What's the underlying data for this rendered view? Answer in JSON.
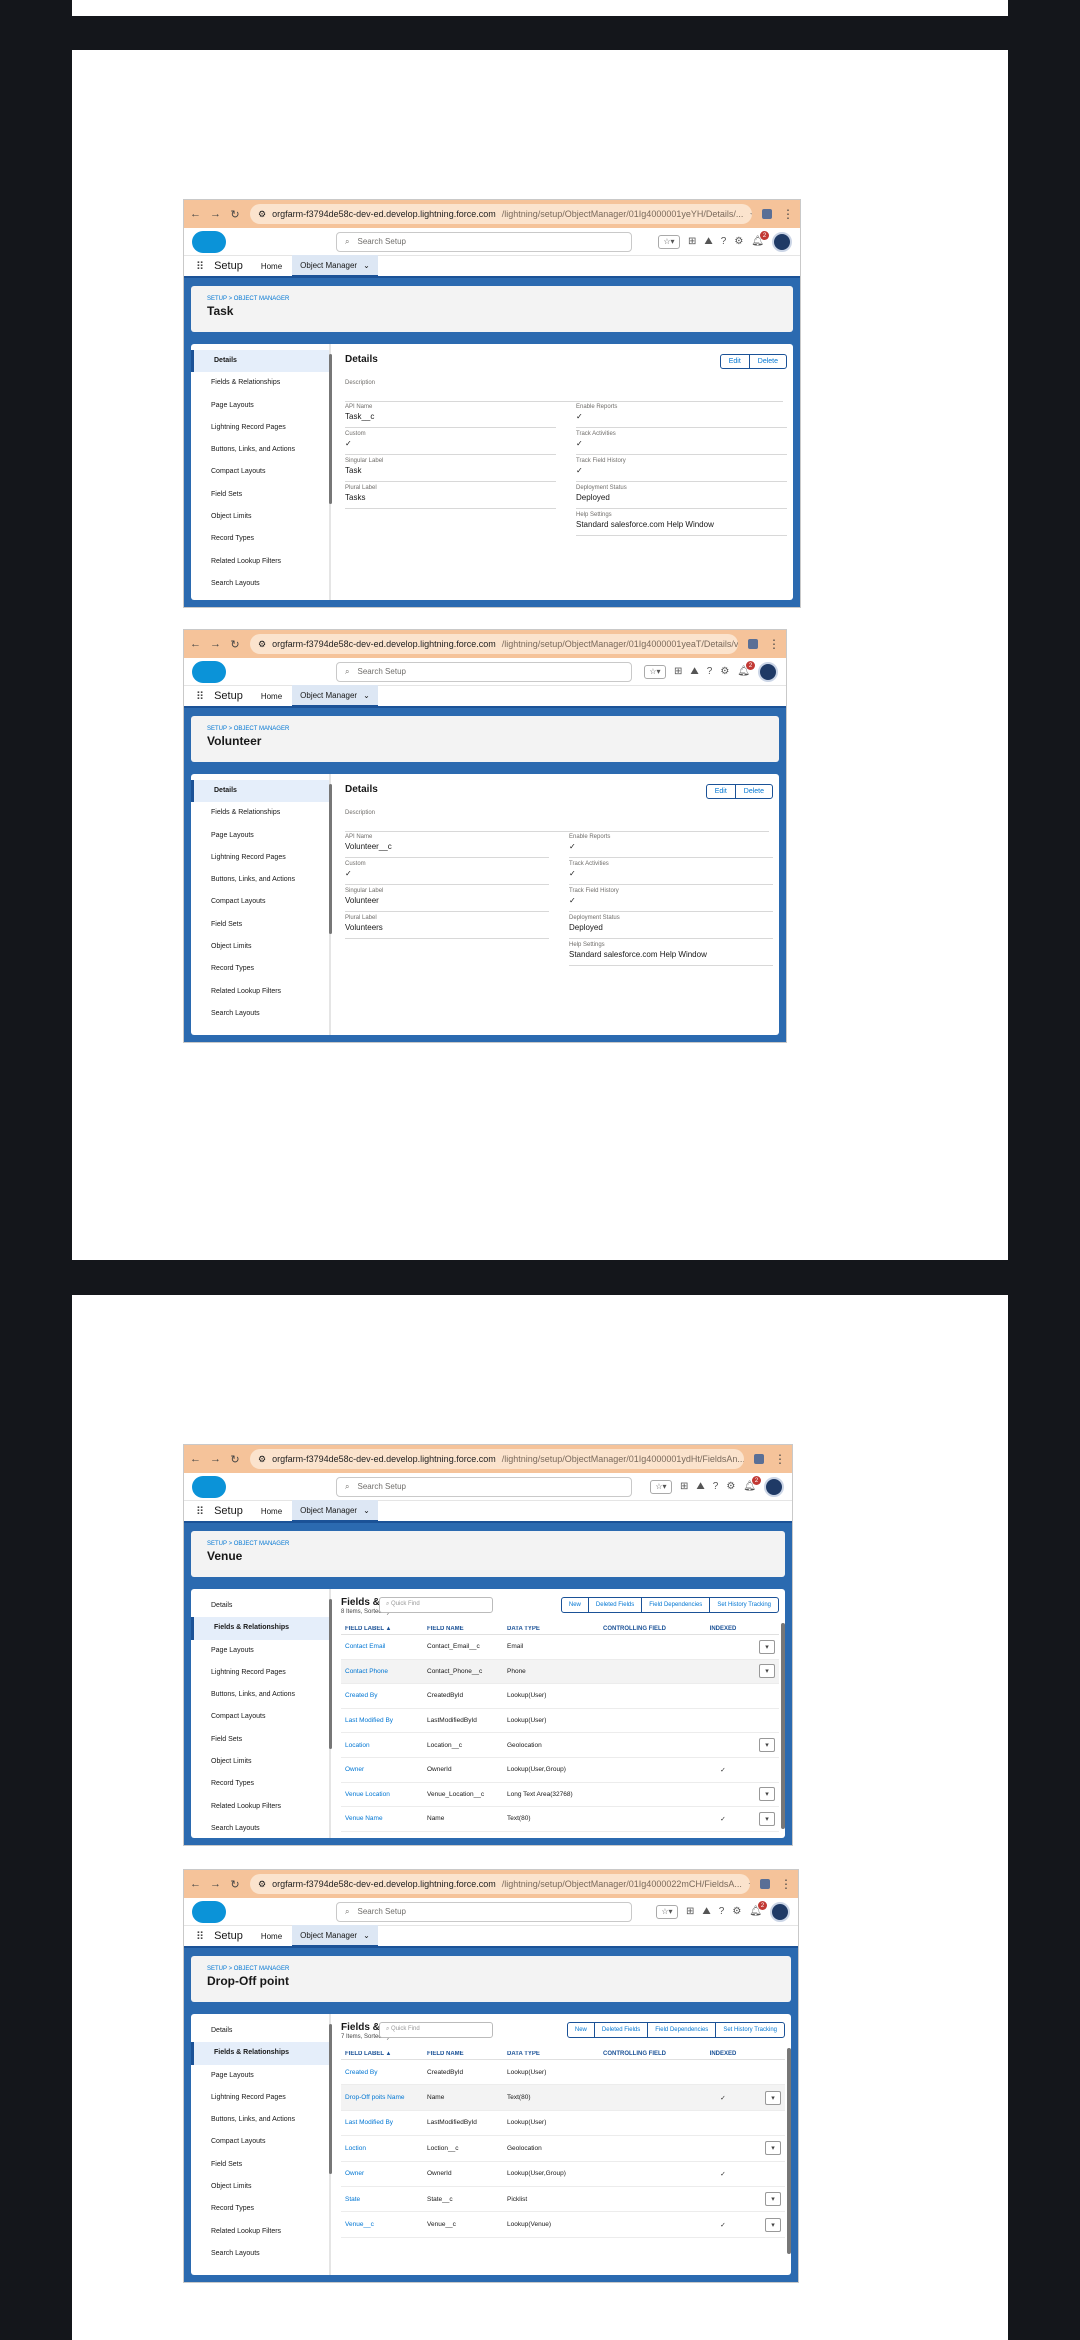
{
  "chrome": {
    "back_icon": "arrow-left-icon",
    "forward_icon": "arrow-right-icon",
    "reload_icon": "reload-icon",
    "tune_icon": "site-info-icon",
    "bookmark_icon": "star-icon",
    "menu_icon": "kebab-menu-icon"
  },
  "global": {
    "search_placeholder": "Search Setup",
    "app_name": "Setup",
    "home_tab": "Home",
    "object_manager_tab": "Object Manager",
    "notification_count": "2"
  },
  "shots": [
    {
      "url_host": "orgfarm-f3794de58c-dev-ed.develop.lightning.force.com",
      "url_path": "/lightning/setup/ObjectManager/01Ig4000001yeYH/Details/...",
      "breadcrumb": "SETUP > OBJECT MANAGER",
      "object_title": "Task",
      "details": {
        "title": "Details",
        "edit": "Edit",
        "delete": "Delete",
        "description_label": "Description",
        "api_name_label": "API Name",
        "api_name": "Task__c",
        "custom_label": "Custom",
        "custom": "✓",
        "singular_label_label": "Singular Label",
        "singular_label": "Task",
        "plural_label_label": "Plural Label",
        "plural_label": "Tasks",
        "enable_reports_label": "Enable Reports",
        "enable_reports": "✓",
        "track_activities_label": "Track Activities",
        "track_activities": "✓",
        "track_field_history_label": "Track Field History",
        "track_field_history": "✓",
        "deployment_status_label": "Deployment Status",
        "deployment_status": "Deployed",
        "help_settings_label": "Help Settings",
        "help_settings": "Standard salesforce.com Help Window"
      }
    },
    {
      "url_host": "orgfarm-f3794de58c-dev-ed.develop.lightning.force.com",
      "url_path": "/lightning/setup/ObjectManager/01Ig4000001yeaT/Details/v...",
      "breadcrumb": "SETUP > OBJECT MANAGER",
      "object_title": "Volunteer",
      "details": {
        "title": "Details",
        "edit": "Edit",
        "delete": "Delete",
        "description_label": "Description",
        "api_name_label": "API Name",
        "api_name": "Volunteer__c",
        "custom_label": "Custom",
        "custom": "✓",
        "singular_label_label": "Singular Label",
        "singular_label": "Volunteer",
        "plural_label_label": "Plural Label",
        "plural_label": "Volunteers",
        "enable_reports_label": "Enable Reports",
        "enable_reports": "✓",
        "track_activities_label": "Track Activities",
        "track_activities": "✓",
        "track_field_history_label": "Track Field History",
        "track_field_history": "✓",
        "deployment_status_label": "Deployment Status",
        "deployment_status": "Deployed",
        "help_settings_label": "Help Settings",
        "help_settings": "Standard salesforce.com Help Window"
      }
    },
    {
      "url_host": "orgfarm-f3794de58c-dev-ed.develop.lightning.force.com",
      "url_path": "/lightning/setup/ObjectManager/01Ig4000001ydHt/FieldsAn...",
      "breadcrumb": "SETUP > OBJECT MANAGER",
      "object_title": "Venue",
      "fields": {
        "title": "Fields & Relationships",
        "subtitle": "8 Items, Sorted by Field Label",
        "quick_find": "Quick Find",
        "new": "New",
        "deleted_fields": "Deleted Fields",
        "field_dependencies": "Field Dependencies",
        "set_history_tracking": "Set History Tracking",
        "columns": [
          "FIELD LABEL",
          "FIELD NAME",
          "DATA TYPE",
          "CONTROLLING FIELD",
          "INDEXED"
        ],
        "rows": [
          {
            "label": "Contact Email",
            "name": "Contact_Email__c",
            "type": "Email",
            "controlling": "",
            "indexed": "",
            "menu": true
          },
          {
            "label": "Contact Phone",
            "name": "Contact_Phone__c",
            "type": "Phone",
            "controlling": "",
            "indexed": "",
            "menu": true
          },
          {
            "label": "Created By",
            "name": "CreatedById",
            "type": "Lookup(User)",
            "controlling": "",
            "indexed": "",
            "menu": false
          },
          {
            "label": "Last Modified By",
            "name": "LastModifiedById",
            "type": "Lookup(User)",
            "controlling": "",
            "indexed": "",
            "menu": false
          },
          {
            "label": "Location",
            "name": "Location__c",
            "type": "Geolocation",
            "controlling": "",
            "indexed": "",
            "menu": true
          },
          {
            "label": "Owner",
            "name": "OwnerId",
            "type": "Lookup(User,Group)",
            "controlling": "",
            "indexed": "✓",
            "menu": false
          },
          {
            "label": "Venue Location",
            "name": "Venue_Location__c",
            "type": "Long Text Area(32768)",
            "controlling": "",
            "indexed": "",
            "menu": true
          },
          {
            "label": "Venue Name",
            "name": "Name",
            "type": "Text(80)",
            "controlling": "",
            "indexed": "✓",
            "menu": true
          }
        ]
      }
    },
    {
      "url_host": "orgfarm-f3794de58c-dev-ed.develop.lightning.force.com",
      "url_path": "/lightning/setup/ObjectManager/01Ig4000022mCH/FieldsA...",
      "breadcrumb": "SETUP > OBJECT MANAGER",
      "object_title": "Drop-Off point",
      "fields": {
        "title": "Fields & Relationships",
        "subtitle": "7 Items, Sorted by Field Label",
        "quick_find": "Quick Find",
        "new": "New",
        "deleted_fields": "Deleted Fields",
        "field_dependencies": "Field Dependencies",
        "set_history_tracking": "Set History Tracking",
        "columns": [
          "FIELD LABEL",
          "FIELD NAME",
          "DATA TYPE",
          "CONTROLLING FIELD",
          "INDEXED"
        ],
        "rows": [
          {
            "label": "Created By",
            "name": "CreatedById",
            "type": "Lookup(User)",
            "controlling": "",
            "indexed": "",
            "menu": false
          },
          {
            "label": "Drop-Off poits Name",
            "name": "Name",
            "type": "Text(80)",
            "controlling": "",
            "indexed": "✓",
            "menu": true
          },
          {
            "label": "Last Modified By",
            "name": "LastModifiedById",
            "type": "Lookup(User)",
            "controlling": "",
            "indexed": "",
            "menu": false
          },
          {
            "label": "Loction",
            "name": "Loction__c",
            "type": "Geolocation",
            "controlling": "",
            "indexed": "",
            "menu": true
          },
          {
            "label": "Owner",
            "name": "OwnerId",
            "type": "Lookup(User,Group)",
            "controlling": "",
            "indexed": "✓",
            "menu": false
          },
          {
            "label": "State",
            "name": "State__c",
            "type": "Picklist",
            "controlling": "",
            "indexed": "",
            "menu": true
          },
          {
            "label": "Venue__c",
            "name": "Venue__c",
            "type": "Lookup(Venue)",
            "controlling": "",
            "indexed": "✓",
            "menu": true
          }
        ]
      }
    }
  ],
  "sidebar_items": [
    "Details",
    "Fields & Relationships",
    "Page Layouts",
    "Lightning Record Pages",
    "Buttons, Links, and Actions",
    "Compact Layouts",
    "Field Sets",
    "Object Limits",
    "Record Types",
    "Related Lookup Filters",
    "Search Layouts"
  ]
}
